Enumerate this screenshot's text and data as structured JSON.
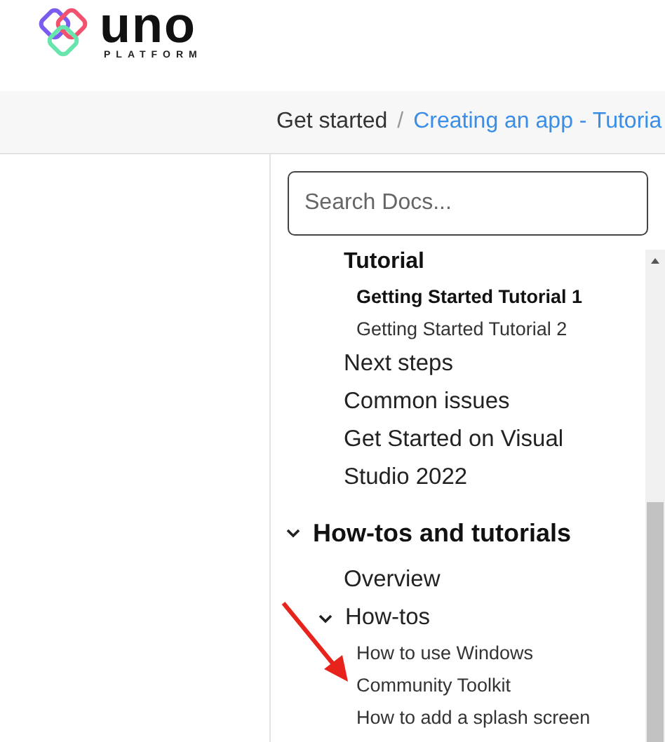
{
  "logo": {
    "wordmark": "uno",
    "subtitle": "PLATFORM"
  },
  "breadcrumb": [
    {
      "label": "Get started",
      "kind": "plain"
    },
    {
      "label": "/",
      "kind": "separator"
    },
    {
      "label": "Creating an app - Tutoria",
      "kind": "link"
    }
  ],
  "search": {
    "placeholder": "Search Docs..."
  },
  "toc": [
    {
      "label": "Tutorial",
      "kind": "group",
      "children": [
        {
          "label": "Getting Started Tutorial 1",
          "selected": true
        },
        {
          "label": "Getting Started Tutorial 2",
          "selected": false
        }
      ]
    },
    {
      "label": "Next steps",
      "kind": "item"
    },
    {
      "label": "Common issues",
      "kind": "item"
    },
    {
      "label": "Get Started on Visual Studio 2022",
      "kind": "item"
    },
    {
      "label": "How-tos and tutorials",
      "kind": "section",
      "expanded": true,
      "children": [
        {
          "label": "Overview",
          "kind": "item"
        },
        {
          "label": "How-tos",
          "kind": "folder",
          "expanded": true,
          "children": [
            {
              "label": "How to use Windows",
              "selected": false
            },
            {
              "label": "Community Toolkit",
              "selected": false
            },
            {
              "label": "How to add a splash screen",
              "selected": false
            }
          ]
        }
      ]
    }
  ]
}
